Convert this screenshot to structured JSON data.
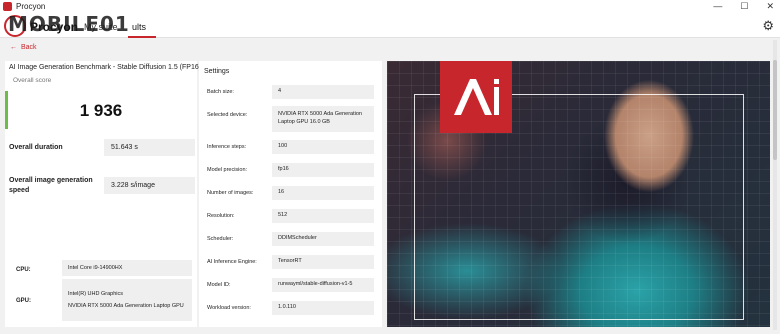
{
  "window": {
    "title": "Procyon",
    "min_glyph": "—",
    "max_glyph": "☐",
    "close_glyph": "✕"
  },
  "header": {
    "brand": "Procyon",
    "tab_suite": "My suite",
    "tab_results": "ults",
    "watermark": "MOBILE01",
    "settings_icon": "gear-icon"
  },
  "back": {
    "arrow": "←",
    "label": "Back"
  },
  "result": {
    "title": "AI Image Generation Benchmark - Stable Diffusion 1.5 (FP16)",
    "score_label": "Overall score",
    "score": "1 936",
    "accent_color": "#6dbb4b",
    "metrics": [
      {
        "label": "Overall duration",
        "value": "51.643 s"
      },
      {
        "label": "Overall image generation speed",
        "value": "3.228 s/image"
      }
    ],
    "system": [
      {
        "label": "CPU:",
        "lines": [
          "Intel Core i9-14900HX"
        ]
      },
      {
        "label": "GPU:",
        "lines": [
          "Intel(R) UHD Graphics",
          "NVIDIA RTX 5000 Ada Generation Laptop GPU"
        ]
      }
    ]
  },
  "settings": {
    "title": "Settings",
    "items": [
      {
        "label": "Batch size:",
        "value": "4"
      },
      {
        "label": "Selected device:",
        "value": "NVIDIA RTX 5000 Ada Generation Laptop GPU 16.0 GB"
      },
      {
        "label": "Inference steps:",
        "value": "100"
      },
      {
        "label": "Model precision:",
        "value": "fp16"
      },
      {
        "label": "Number of images:",
        "value": "16"
      },
      {
        "label": "Resolution:",
        "value": "512"
      },
      {
        "label": "Scheduler:",
        "value": "DDIMScheduler"
      },
      {
        "label": "AI Inference Engine:",
        "value": "TensorRT"
      },
      {
        "label": "Model ID:",
        "value": "runwayml/stable-diffusion-v1-5"
      },
      {
        "label": "Workload version:",
        "value": "1.0.110"
      }
    ]
  },
  "brand_color": "#c8262d"
}
